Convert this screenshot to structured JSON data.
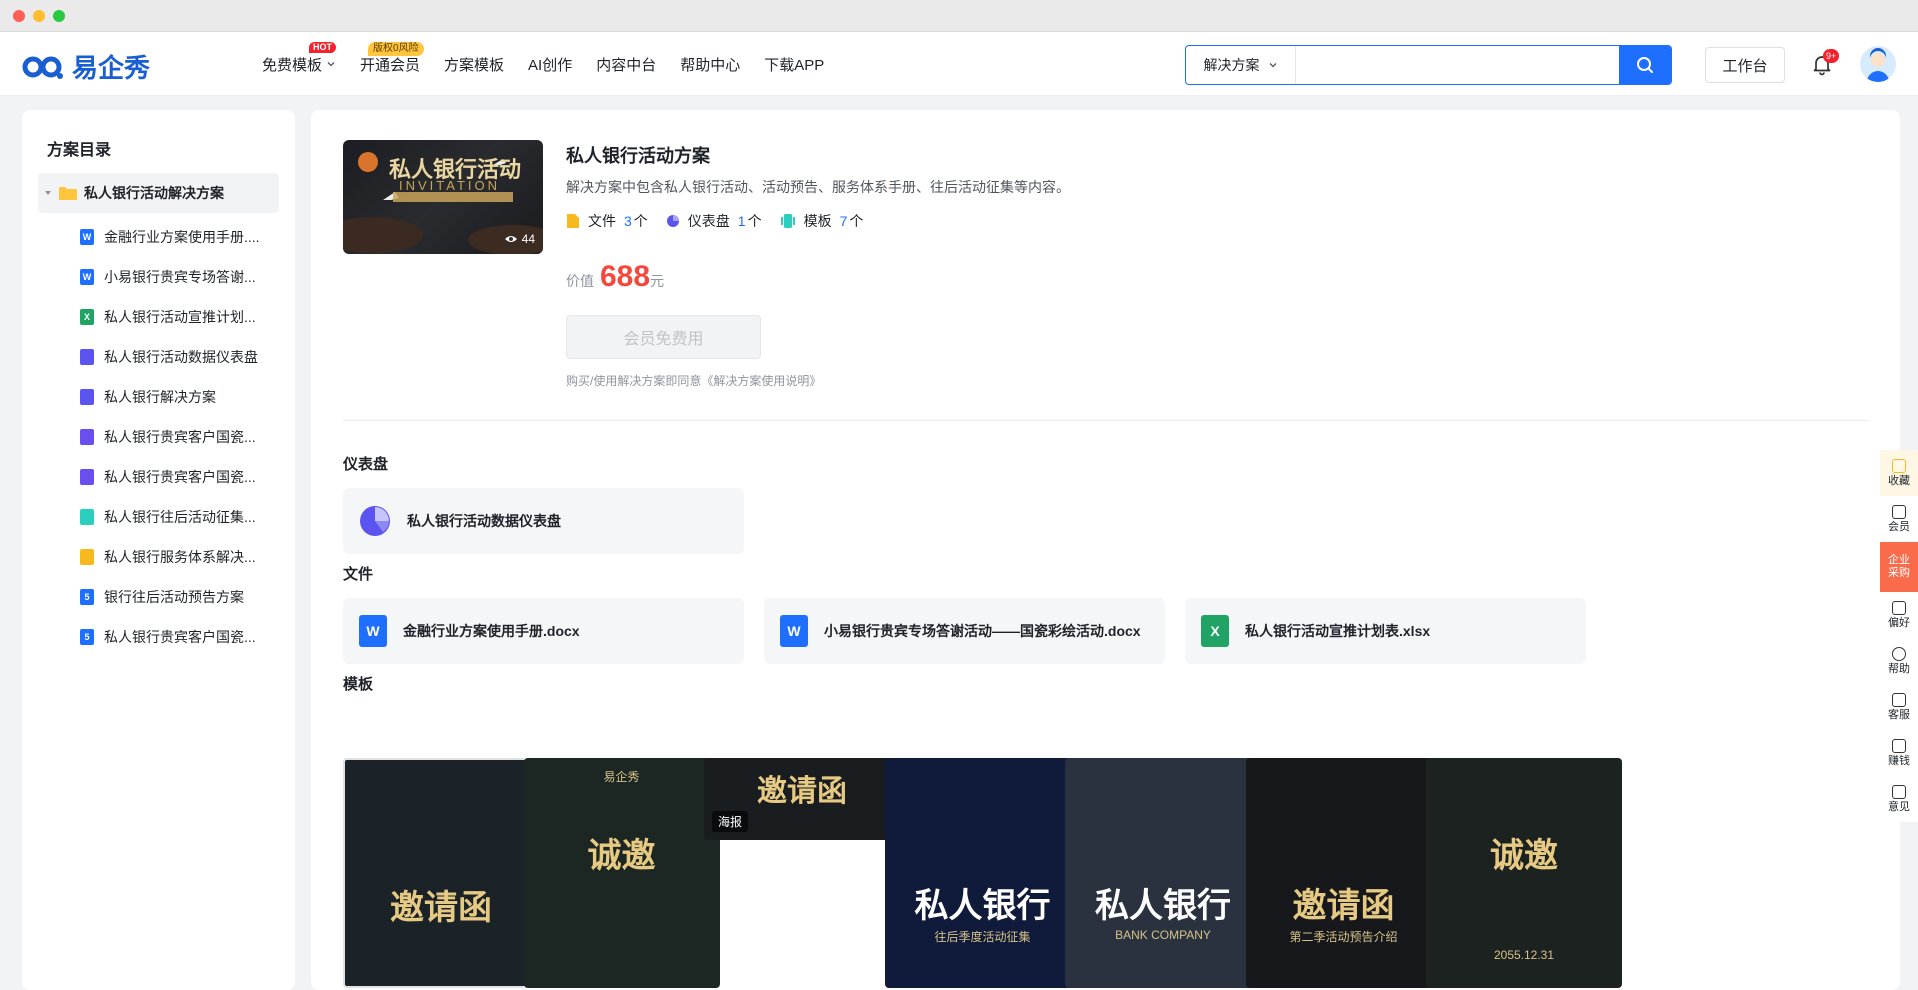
{
  "header": {
    "logo_text": "易企秀",
    "nav": [
      {
        "label": "免费模板",
        "badge": "HOT",
        "dropdown": true
      },
      {
        "label": "开通会员",
        "badge": "版权0风险"
      },
      {
        "label": "方案模板"
      },
      {
        "label": "AI创作"
      },
      {
        "label": "内容中台"
      },
      {
        "label": "帮助中心"
      },
      {
        "label": "下载APP"
      }
    ],
    "search": {
      "type": "解决方案",
      "placeholder": ""
    },
    "workbench": "工作台",
    "notif_badge": "9+"
  },
  "sidebar": {
    "title": "方案目录",
    "folder": "私人银行活动解决方案",
    "items": [
      {
        "label": "金融行业方案使用手册....",
        "icon": "word-icon",
        "color": "#1e6fff",
        "glyph": "W"
      },
      {
        "label": "小易银行贵宾专场答谢...",
        "icon": "word-icon",
        "color": "#1e6fff",
        "glyph": "W"
      },
      {
        "label": "私人银行活动宣推计划...",
        "icon": "excel-icon",
        "color": "#21a366",
        "glyph": "X"
      },
      {
        "label": "私人银行活动数据仪表盘",
        "icon": "dashboard-icon",
        "color": "#5b54f0",
        "glyph": ""
      },
      {
        "label": "私人银行解决方案",
        "icon": "book-icon",
        "color": "#5b54f0",
        "glyph": ""
      },
      {
        "label": "私人银行贵宾客户国瓷...",
        "icon": "image-icon",
        "color": "#6c4df0",
        "glyph": ""
      },
      {
        "label": "私人银行贵宾客户国瓷...",
        "icon": "image-icon",
        "color": "#6c4df0",
        "glyph": ""
      },
      {
        "label": "私人银行往后活动征集...",
        "icon": "form-icon",
        "color": "#2ccfbd",
        "glyph": ""
      },
      {
        "label": "私人银行服务体系解决...",
        "icon": "doc-icon",
        "color": "#f7ba1e",
        "glyph": ""
      },
      {
        "label": "银行往后活动预告方案",
        "icon": "h5-icon",
        "color": "#1e6fff",
        "glyph": "5"
      },
      {
        "label": "私人银行贵宾客户国瓷...",
        "icon": "h5-icon",
        "color": "#1e6fff",
        "glyph": "5"
      }
    ]
  },
  "solution": {
    "cover_views": "44",
    "cover_title": "私人银行活动",
    "cover_sub": "INVITATION",
    "title": "私人银行活动方案",
    "desc": "解决方案中包含私人银行活动、活动预告、服务体系手册、往后活动征集等内容。",
    "stats": [
      {
        "label": "文件",
        "count": "3",
        "unit": "个"
      },
      {
        "label": "仪表盘",
        "count": "1",
        "unit": "个"
      },
      {
        "label": "模板",
        "count": "7",
        "unit": "个"
      }
    ],
    "price_label": "价值",
    "price": "688",
    "price_unit": "元",
    "free_btn": "会员免费用",
    "agree": "购买/使用解决方案即同意《解决方案使用说明》"
  },
  "dashboard_section": {
    "title": "仪表盘",
    "items": [
      {
        "label": "私人银行活动数据仪表盘"
      }
    ]
  },
  "file_section": {
    "title": "文件",
    "items": [
      {
        "label": "金融行业方案使用手册.docx",
        "glyph": "W",
        "color": "#1e6fff"
      },
      {
        "label": "小易银行贵宾专场答谢活动——国瓷彩绘活动.docx",
        "glyph": "W",
        "color": "#1e6fff"
      },
      {
        "label": "私人银行活动宣推计划表.xlsx",
        "glyph": "X",
        "color": "#21a366"
      }
    ]
  },
  "template_section": {
    "title": "模板",
    "items": [
      {
        "big": "邀请函",
        "small": ""
      },
      {
        "big": "诚邀",
        "small": "易企秀"
      },
      {
        "big": "邀请函",
        "small": "",
        "tag": "海报"
      },
      {
        "big": "私人银行",
        "small": "往后季度活动征集"
      },
      {
        "big": "私人银行",
        "small": "BANK COMPANY"
      },
      {
        "big": "邀请函",
        "small": "第二季活动预告介绍"
      },
      {
        "big": "诚邀",
        "small": "2055.12.31"
      }
    ]
  },
  "floatbar": [
    "收藏",
    "会员",
    "企业采购",
    "偏好",
    "帮助",
    "客服",
    "赚钱",
    "意见"
  ]
}
